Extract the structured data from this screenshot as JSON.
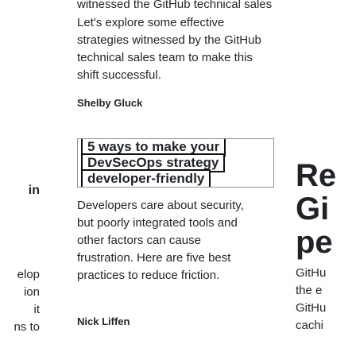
{
  "left_card": {
    "title": "in",
    "description_lines": [
      "elop",
      "ion",
      "it",
      "ns to"
    ]
  },
  "center_card_top": {
    "cut_line": "witnessed the GitHub technical sales team",
    "description": "Let's explore some effective strategies witnessed by the GitHub technical sales team to make this shift successful.",
    "author": "Shelby Gluck"
  },
  "center_card_bottom": {
    "image_headline": [
      "5 ways to make your",
      "DevSecOps strategy",
      "developer-friendly"
    ],
    "description": "Developers care about security, but poorly integrated tools and other factors can cause frustration. Here are five best practices to reduce friction.",
    "author": "Nick Liffen"
  },
  "right_card": {
    "title_lines": [
      "Re",
      "Gi",
      "pe"
    ],
    "description_lines": [
      "GitHu",
      "the e",
      "GitHu",
      "cachi"
    ]
  }
}
